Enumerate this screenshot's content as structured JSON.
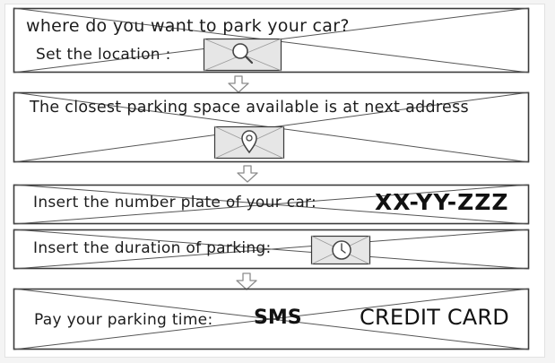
{
  "panel_location": {
    "question": "where do you want to park your car?",
    "prompt": "Set the location :",
    "icon": "search-icon"
  },
  "panel_closest": {
    "text": "The closest parking space available is at next address",
    "icon": "map-pin-icon"
  },
  "panel_plate": {
    "label": "Insert the number plate of your car:",
    "plate_value": "XX-YY-ZZZ"
  },
  "panel_duration": {
    "label": "Insert the duration of parking:",
    "icon": "clock-icon"
  },
  "panel_payment": {
    "label": "Pay your parking time:",
    "sms_label": "SMS",
    "card_label": "CREDIT CARD"
  },
  "colors": {
    "stroke": "#3a3a3a",
    "image_fill": "#e6e6e6",
    "arrow": "#8c8c8c"
  }
}
